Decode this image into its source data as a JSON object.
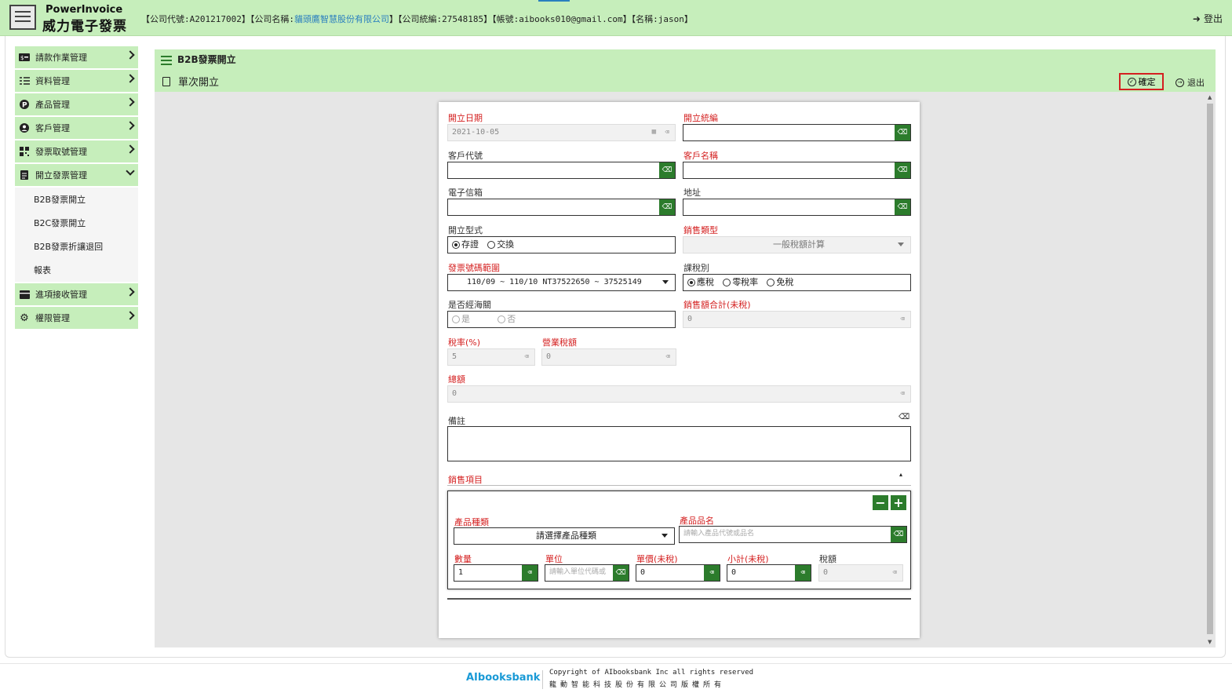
{
  "header": {
    "logo_line1": "PowerInvoice",
    "logo_line2": "威力電子發票",
    "info_prefix": "【公司代號:A201217002】【公司名稱:",
    "company_name": "貓頭鷹智慧股份有限公司",
    "info_suffix": "】【公司統編:27548185】【帳號:aibooks010@gmail.com】【名稱:jason】",
    "logout_label": "登出"
  },
  "sidebar": {
    "items": [
      {
        "label": "請款作業管理",
        "icon": "dollar-card-icon"
      },
      {
        "label": "資料管理",
        "icon": "list-check-icon"
      },
      {
        "label": "產品管理",
        "icon": "product-p-icon"
      },
      {
        "label": "客戶管理",
        "icon": "user-circle-icon"
      },
      {
        "label": "發票取號管理",
        "icon": "grid-icon"
      },
      {
        "label": "開立發票管理",
        "icon": "document-icon"
      },
      {
        "label": "進項接收管理",
        "icon": "wallet-icon"
      },
      {
        "label": "權限管理",
        "icon": "gear-icon"
      }
    ],
    "subitems": [
      "B2B發票開立",
      "B2C發票開立",
      "B2B發票折讓退回",
      "報表"
    ]
  },
  "page": {
    "title": "B2B發票開立",
    "subtitle": "單次開立",
    "confirm_label": "確定",
    "exit_label": "退出"
  },
  "form": {
    "issue_date": {
      "label": "開立日期",
      "value": "2021-10-05"
    },
    "tax_id": {
      "label": "開立統編",
      "value": ""
    },
    "customer_code": {
      "label": "客戶代號",
      "value": ""
    },
    "customer_name": {
      "label": "客戶名稱",
      "value": ""
    },
    "email": {
      "label": "電子信箱",
      "value": ""
    },
    "address": {
      "label": "地址",
      "value": ""
    },
    "issue_type": {
      "label": "開立型式",
      "options": [
        "存證",
        "交換"
      ],
      "selected": "存證"
    },
    "sales_type": {
      "label": "銷售類型",
      "value": "一般稅額計算"
    },
    "invoice_range": {
      "label": "發票號碼範圍",
      "value": "110/09 ~ 110/10 NT37522650 ~ 37525149"
    },
    "tax_category": {
      "label": "課稅別",
      "options": [
        "應稅",
        "零稅率",
        "免稅"
      ],
      "selected": "應稅"
    },
    "customs": {
      "label": "是否經海關",
      "options": [
        "是",
        "否"
      ]
    },
    "sales_total": {
      "label": "銷售額合計(未稅)",
      "value": "0"
    },
    "tax_rate": {
      "label": "稅率(%)",
      "value": "5"
    },
    "business_tax": {
      "label": "營業稅額",
      "value": "0"
    },
    "total": {
      "label": "總額",
      "value": "0"
    },
    "remark": {
      "label": "備註",
      "value": ""
    },
    "sales_items_label": "銷售項目",
    "item": {
      "category_label": "產品種類",
      "category_value": "請選擇產品種類",
      "product_name_label": "產品品名",
      "product_name_placeholder": "請輸入產品代號或品名",
      "qty_label": "數量",
      "qty_value": "1",
      "unit_label": "單位",
      "unit_placeholder": "請輸入單位代碼或",
      "price_label": "單價(未稅)",
      "price_value": "0",
      "subtotal_label": "小計(未稅)",
      "subtotal_value": "0",
      "tax_label": "稅額",
      "tax_value": "0"
    }
  },
  "footer": {
    "brand": "AIbooksbank",
    "copyright": "Copyright of AIbooksbank Inc all rights reserved",
    "copyright_zh": "龍動智能科技股份有限公司版權所有"
  }
}
